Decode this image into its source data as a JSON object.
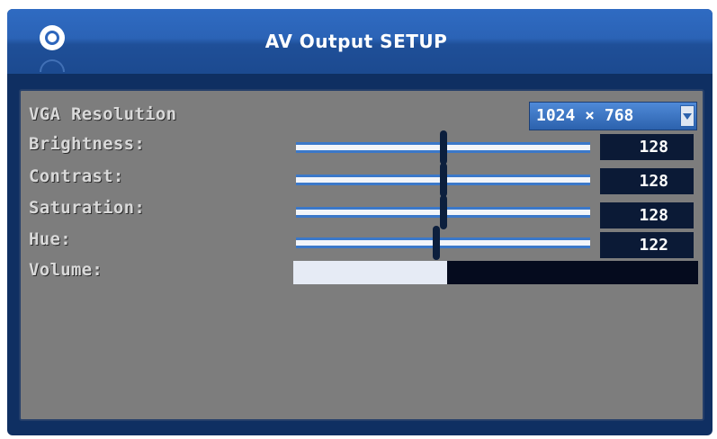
{
  "window": {
    "title": "AV Output SETUP"
  },
  "settings": {
    "vga_resolution": {
      "label": "VGA Resolution",
      "value": "1024 × 768"
    },
    "brightness": {
      "label": "Brightness:",
      "value": "128",
      "level": 0.5
    },
    "contrast": {
      "label": "Contrast:",
      "value": "128",
      "level": 0.5
    },
    "saturation": {
      "label": "Saturation:",
      "value": "128",
      "level": 0.5
    },
    "hue": {
      "label": "Hue:",
      "value": "122",
      "level": 0.477
    },
    "volume": {
      "label": "Volume:",
      "level": 0.38
    }
  },
  "colors": {
    "title_bar": "#2b63b6",
    "panel": "#7d7d7d",
    "slider_track": "#3b78c9",
    "value_box": "#0b1a36"
  },
  "icons": {
    "title_logo": "ring-logo-icon",
    "dropdown": "dropdown-arrow-icon"
  }
}
